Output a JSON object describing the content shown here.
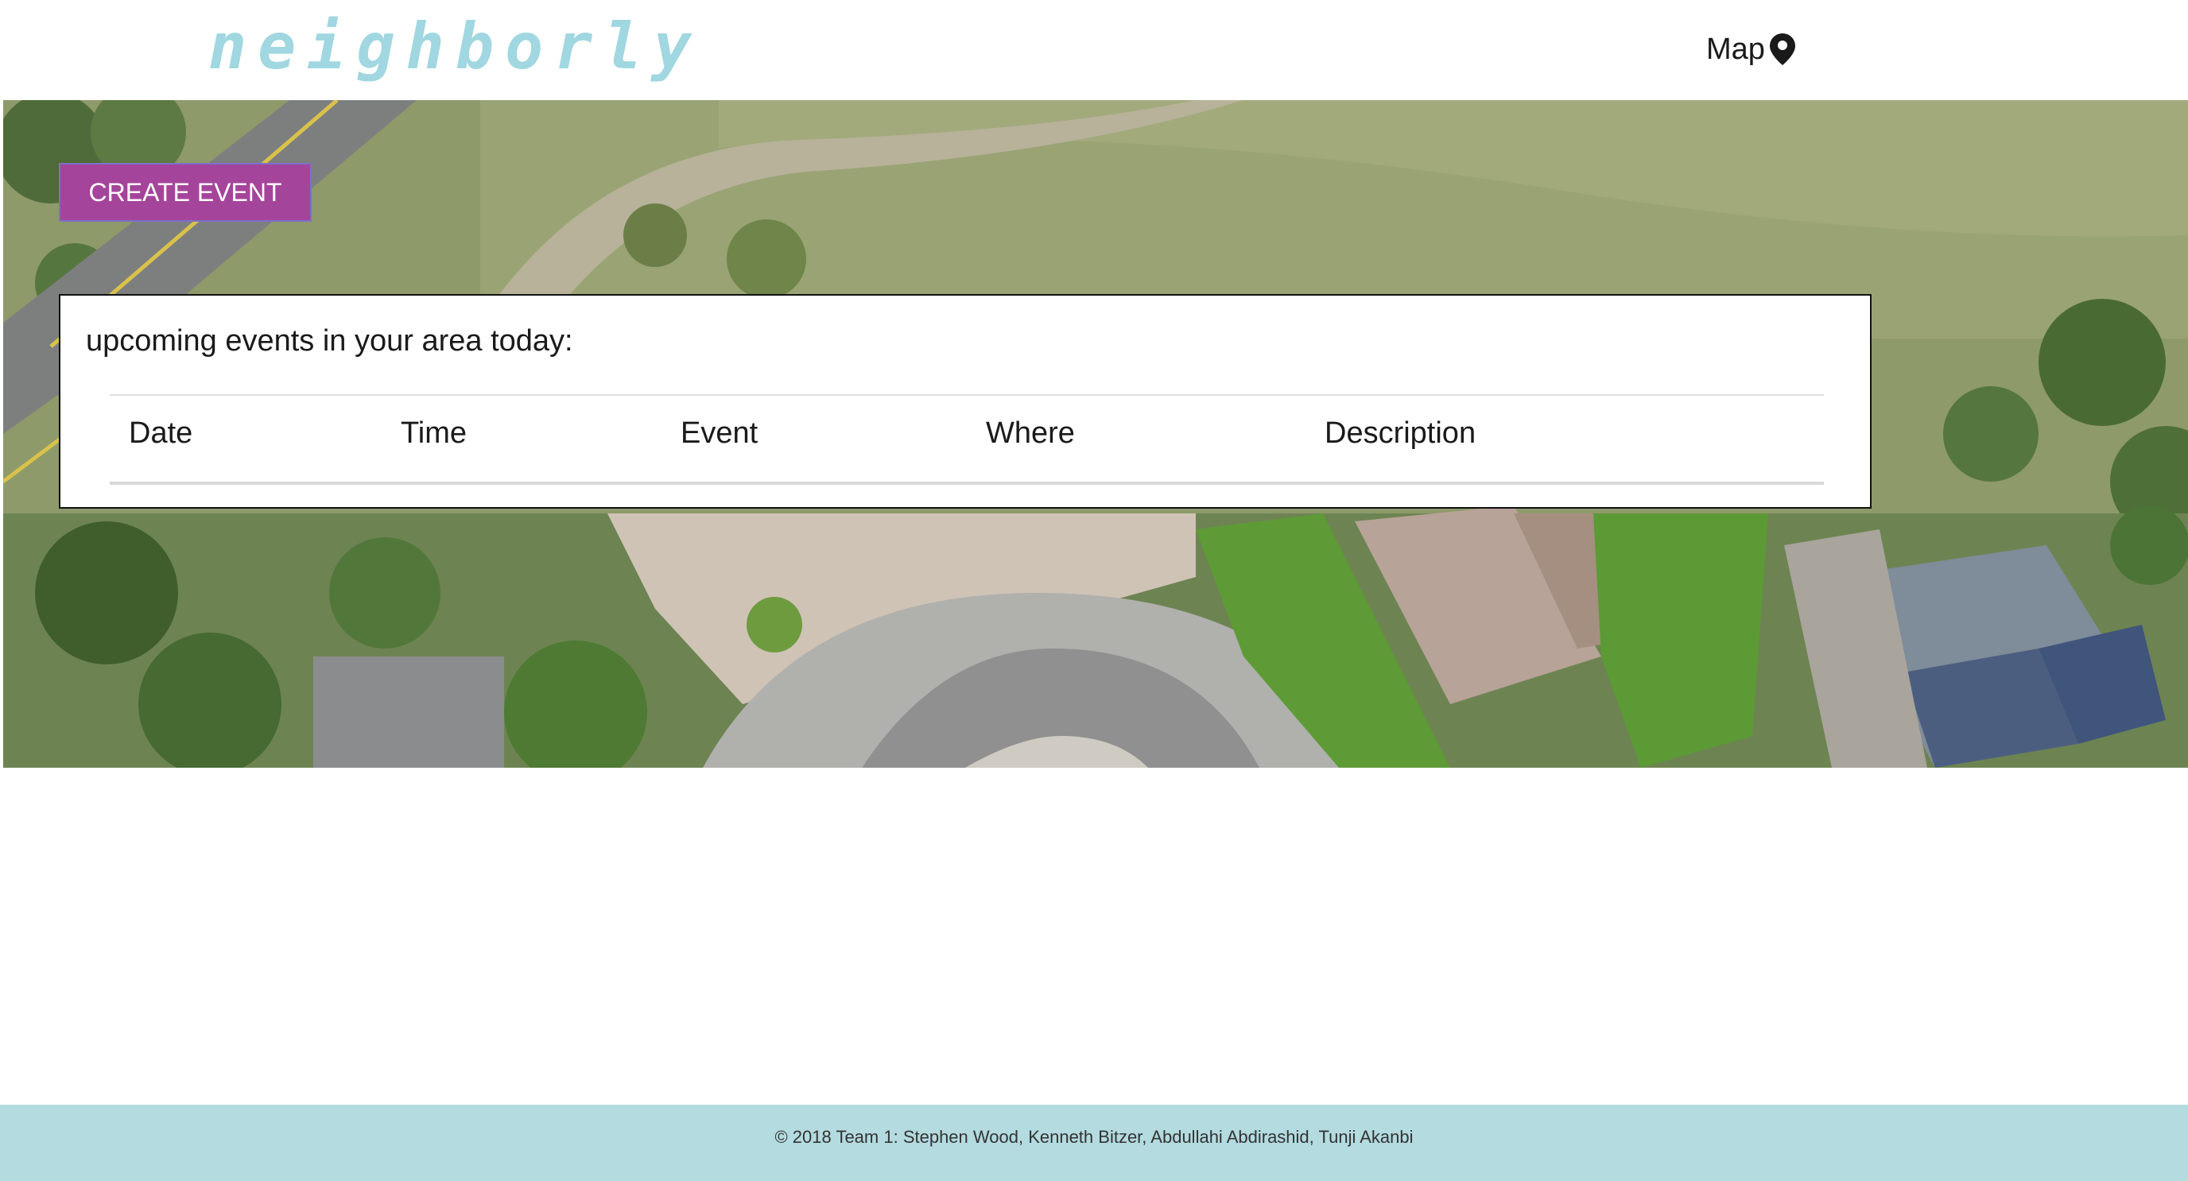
{
  "brand": {
    "logo_text": "neighborly",
    "logo_color": "#a0d7e0"
  },
  "nav": {
    "map_label": "Map",
    "map_icon": "map-marker-icon"
  },
  "hero": {
    "create_event_label": "CREATE EVENT",
    "button_color": "#a5449b"
  },
  "events": {
    "heading": "upcoming events in your area today:",
    "columns": [
      "Date",
      "Time",
      "Event",
      "Where",
      "Description"
    ],
    "rows": []
  },
  "footer": {
    "copyright": "© 2018 Team 1: Stephen Wood, Kenneth Bitzer, Abdullahi Abdirashid, Tunji Akanbi",
    "background": "#b3dbe0"
  }
}
